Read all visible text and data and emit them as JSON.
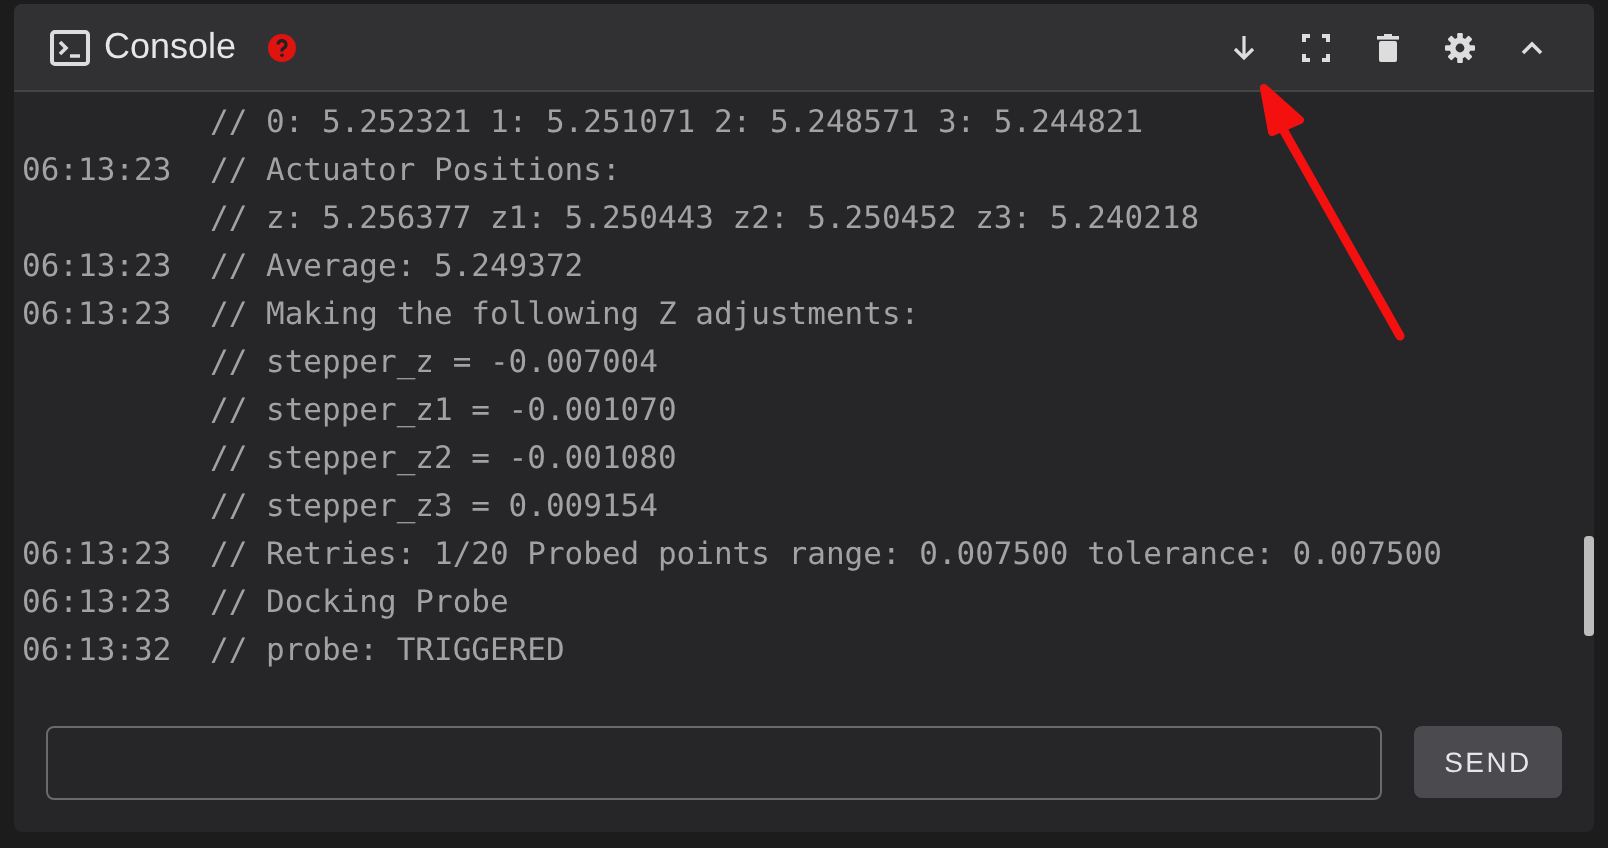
{
  "header": {
    "title": "Console",
    "buttons": [
      {
        "kind": "scroll-down"
      },
      {
        "kind": "fullscreen"
      },
      {
        "kind": "clear"
      },
      {
        "kind": "settings"
      },
      {
        "kind": "collapse"
      }
    ]
  },
  "log": [
    {
      "message": "// 0: 5.252321 1: 5.251071 2: 5.248571 3: 5.244821"
    },
    {
      "time": "06:13:23",
      "message": "// Actuator Positions:"
    },
    {
      "message": "// z: 5.256377 z1: 5.250443 z2: 5.250452 z3: 5.240218"
    },
    {
      "time": "06:13:23",
      "message": "// Average: 5.249372"
    },
    {
      "time": "06:13:23",
      "message": "// Making the following Z adjustments:"
    },
    {
      "message": "// stepper_z = -0.007004"
    },
    {
      "message": "// stepper_z1 = -0.001070"
    },
    {
      "message": "// stepper_z2 = -0.001080"
    },
    {
      "message": "// stepper_z3 = 0.009154"
    },
    {
      "time": "06:13:23",
      "message": "// Retries: 1/20 Probed points range: 0.007500 tolerance: 0.007500"
    },
    {
      "time": "06:13:23",
      "message": "// Docking Probe"
    },
    {
      "time": "06:13:32",
      "message": "// probe: TRIGGERED"
    }
  ],
  "send_button": "SEND"
}
